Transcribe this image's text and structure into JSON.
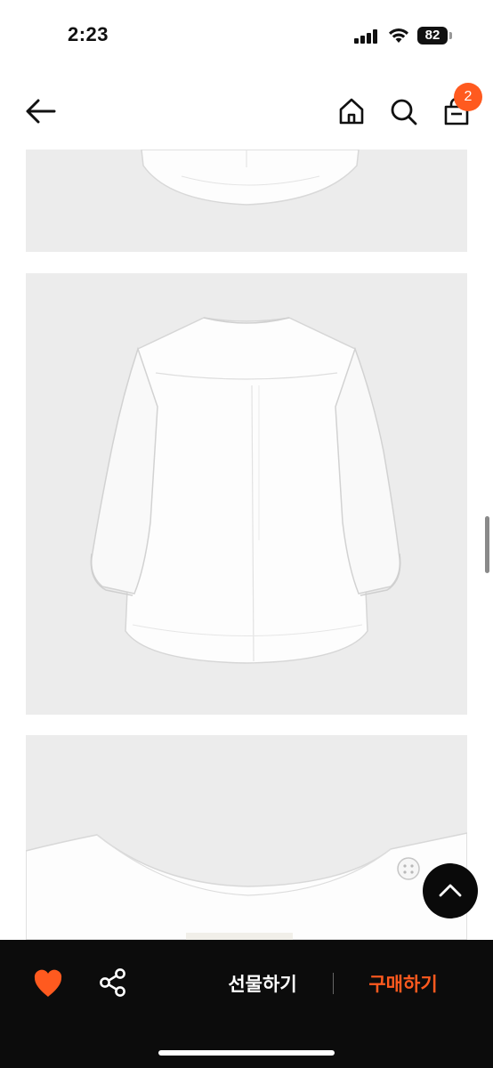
{
  "status_bar": {
    "time": "2:23",
    "battery": "82"
  },
  "nav": {
    "back_icon": "arrow-left-icon",
    "home_icon": "home-icon",
    "search_icon": "search-icon",
    "cart_icon": "shopping-bag-icon",
    "cart_count": "2",
    "badge_color": "#ff5a1f"
  },
  "images": [
    {
      "name": "shirt-hem-detail-image"
    },
    {
      "name": "shirt-back-view-image"
    },
    {
      "name": "shirt-collar-button-detail-image"
    }
  ],
  "scroll_top": {
    "icon": "chevron-up-icon"
  },
  "actions": {
    "wishlist_icon": "heart-icon",
    "share_icon": "share-icon",
    "gift_label": "선물하기",
    "buy_label": "구매하기",
    "buy_color": "#ff5a1f",
    "wishlist_color": "#ff5a1f"
  }
}
